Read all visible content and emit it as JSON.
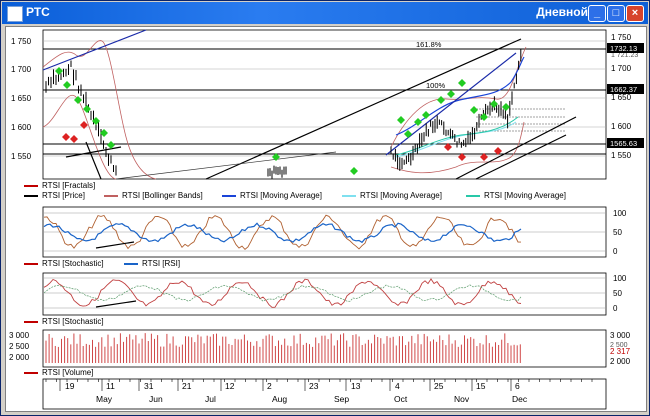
{
  "window": {
    "title": "РТС",
    "timeframe": "Дневной",
    "buttons": {
      "minimize": "_",
      "maximize": "□",
      "close": "×"
    }
  },
  "panels": {
    "price": {
      "axis_left": [
        "1 750",
        "1 700",
        "1 650",
        "1 600",
        "1 550"
      ],
      "axis_right": [
        "1 750",
        "1 700",
        "1 650",
        "1 600",
        "1 550"
      ],
      "right_small": [
        "1 721.23"
      ],
      "right_boxes": {
        "top": "1732.13",
        "mid": "1662.37",
        "low": "1565.63"
      },
      "fib_labels": [
        "161.8%",
        "100%"
      ],
      "legends": [
        {
          "label": "RTSI [Fractals]",
          "color": "#c00000"
        },
        {
          "label": "RTSI [Price]",
          "color": "#000000"
        },
        {
          "label": "RTSI [Bollinger Bands]",
          "color": "#c06060"
        },
        {
          "label": "RTSI [Moving Average]",
          "color": "#1a44d8"
        },
        {
          "label": "RTSI [Moving Average]",
          "color": "#7fe0ef"
        },
        {
          "label": "RTSI [Moving Average]",
          "color": "#28c8a8"
        }
      ]
    },
    "osc1": {
      "axis_right": [
        "100",
        "50",
        "0"
      ],
      "legends": [
        {
          "label": "RTSI [Stochastic]",
          "color": "#c00000"
        },
        {
          "label": "RTSI [RSI]",
          "color": "#1a64c8"
        }
      ]
    },
    "osc2": {
      "axis_right": [
        "100",
        "50",
        "0"
      ],
      "legends": [
        {
          "label": "RTSI [Stochastic]",
          "color": "#c00000"
        }
      ]
    },
    "volume": {
      "axis_left": [
        "3 000",
        "2 500",
        "2 000"
      ],
      "axis_right": [
        "3 000",
        "2 500",
        "2 000"
      ],
      "last_value": "2 317",
      "legends": [
        {
          "label": "RTSI [Volume]",
          "color": "#c00000"
        }
      ]
    }
  },
  "time_axis": {
    "days": [
      "19",
      "11",
      "31",
      "21",
      "12",
      "2",
      "23",
      "13",
      "4",
      "25",
      "15",
      "6"
    ],
    "months": [
      "May",
      "Jun",
      "Jul",
      "Aug",
      "Sep",
      "Oct",
      "Nov",
      "Dec"
    ]
  }
}
